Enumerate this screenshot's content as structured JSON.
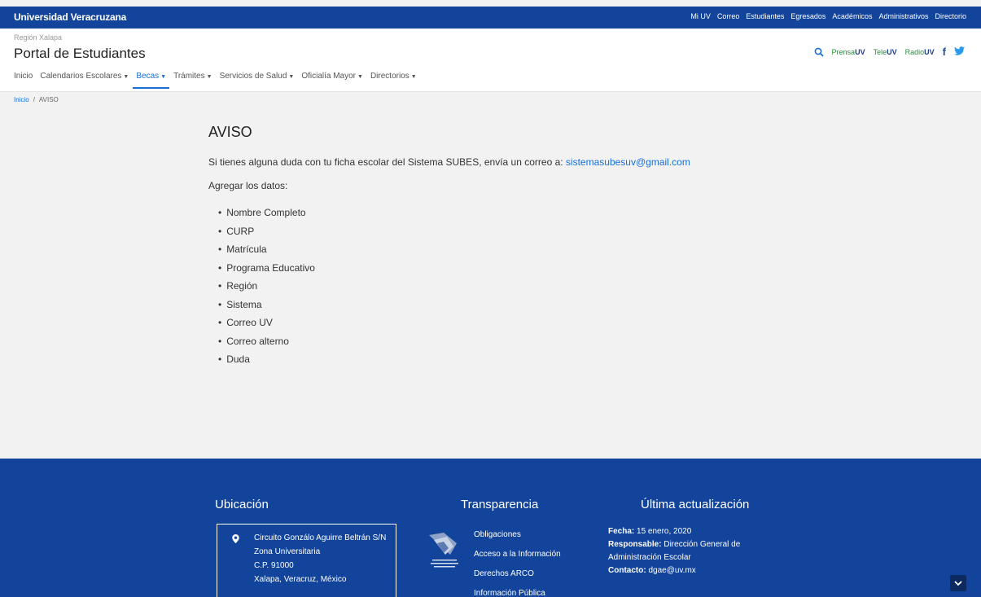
{
  "topbar": {
    "brand": "Universidad Veracruzana",
    "links": [
      "Mi UV",
      "Correo",
      "Estudiantes",
      "Egresados",
      "Académicos",
      "Administrativos",
      "Directorio"
    ]
  },
  "header": {
    "region": "Región Xalapa",
    "title": "Portal de Estudiantes",
    "nav": [
      {
        "label": "Inicio",
        "dropdown": false,
        "active": false
      },
      {
        "label": "Calendarios Escolares",
        "dropdown": true,
        "active": false
      },
      {
        "label": "Becas",
        "dropdown": true,
        "active": true
      },
      {
        "label": "Trámites",
        "dropdown": true,
        "active": false
      },
      {
        "label": "Servicios de Salud",
        "dropdown": true,
        "active": false
      },
      {
        "label": "Oficialía Mayor",
        "dropdown": true,
        "active": false
      },
      {
        "label": "Directorios",
        "dropdown": true,
        "active": false
      }
    ],
    "media": {
      "prensa_a": "Prensa",
      "prensa_b": "UV",
      "tele_a": "Tele",
      "tele_b": "UV",
      "radio_a": "Radio",
      "radio_b": "UV"
    }
  },
  "breadcrumb": {
    "home": "Inicio",
    "separator": "/",
    "current": "AVISO"
  },
  "content": {
    "title": "AVISO",
    "intro": "Si tienes alguna duda con tu ficha escolar del Sistema SUBES, envía un correo a: ",
    "email": "sistemasubesuv@gmail.com",
    "instruction": "Agregar los datos:",
    "items": [
      "Nombre Completo",
      "CURP",
      "Matrícula",
      "Programa Educativo",
      "Región",
      "Sistema",
      "Correo UV",
      "Correo alterno",
      "Duda"
    ]
  },
  "footer": {
    "ubicacion": {
      "title": "Ubicación",
      "lines": [
        "Circuito Gonzálo Aguirre Beltrán S/N",
        "Zona Universitaria",
        "C.P. 91000",
        "Xalapa, Veracruz, México"
      ]
    },
    "transparencia": {
      "title": "Transparencia",
      "links": [
        "Obligaciones",
        "Acceso a la Información",
        "Derechos ARCO",
        "Información Pública"
      ]
    },
    "actualizacion": {
      "title": "Última actualización",
      "fecha_label": "Fecha:",
      "fecha": " 15 enero, 2020",
      "resp_label": "Responsable:",
      "resp": " Dirección General de Administración Escolar",
      "contacto_label": "Contacto:",
      "contacto": " dgae@uv.mx"
    }
  },
  "colors": {
    "primary": "#12449b",
    "link": "#1a6fd6",
    "green": "#2e8b3e"
  }
}
